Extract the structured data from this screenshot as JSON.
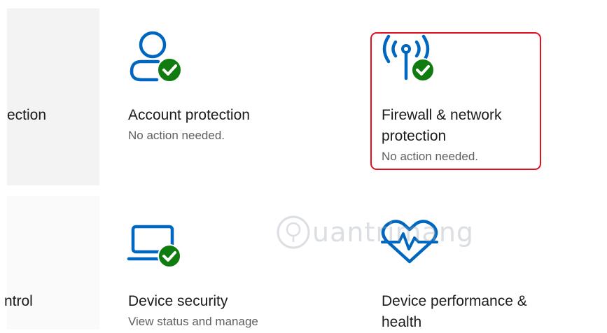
{
  "tiles": {
    "partial_top": {
      "title": "ection"
    },
    "account": {
      "title": "Account protection",
      "status": "No action needed.",
      "icon": "account-check-icon"
    },
    "firewall": {
      "title_line1": "Firewall & network",
      "title_line2": "protection",
      "status": "No action needed.",
      "icon": "wifi-antenna-check-icon"
    },
    "partial_bottom": {
      "title": "ntrol"
    },
    "device_security": {
      "title": "Device security",
      "status": "View status and manage",
      "icon": "laptop-check-icon"
    },
    "device_performance": {
      "title_line1": "Device performance &",
      "title_line2": "health",
      "icon": "heart-pulse-icon"
    }
  },
  "watermark": {
    "text": "uantrimang"
  },
  "colors": {
    "accent": "#0067c0",
    "check": "#107c10",
    "highlight": "#e0101e"
  }
}
